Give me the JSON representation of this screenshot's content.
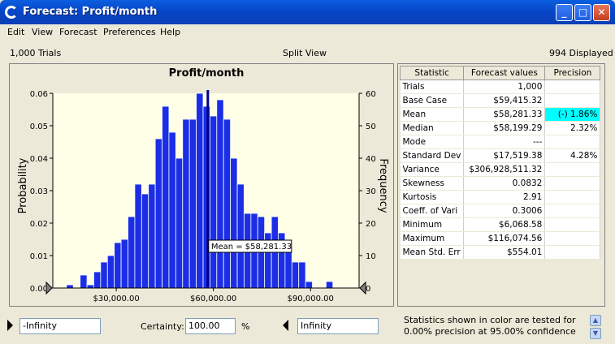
{
  "window": {
    "title": "Forecast: Profit/month"
  },
  "menu": [
    "Edit",
    "View",
    "Forecast",
    "Preferences",
    "Help"
  ],
  "info": {
    "trials": "1,000 Trials",
    "view": "Split View",
    "displayed": "994 Displayed"
  },
  "chart_data": {
    "type": "bar",
    "title": "Profit/month",
    "ylabel_left": "Probability",
    "ylabel_right": "Frequency",
    "xlim": [
      10400,
      105000
    ],
    "ylim_left": [
      0,
      0.06
    ],
    "ylim_right": [
      0,
      60
    ],
    "x_ticks": [
      30000,
      60000,
      90000
    ],
    "x_tick_labels": [
      "$30,000.00",
      "$60,000.00",
      "$90,000.00"
    ],
    "y_ticks_left": [
      "0.00",
      "0.01",
      "0.02",
      "0.03",
      "0.04",
      "0.05",
      "0.06"
    ],
    "y_ticks_right": [
      "0",
      "10",
      "20",
      "30",
      "40",
      "50",
      "60"
    ],
    "bin_start": 10400,
    "bin_width": 2110,
    "frequencies": [
      0,
      0,
      1,
      0,
      4,
      1,
      5,
      8,
      10,
      14,
      15,
      22,
      32,
      29,
      32,
      46,
      56,
      48,
      40,
      52,
      52,
      60,
      56,
      53,
      58,
      52,
      40,
      32,
      23,
      23,
      22,
      17,
      22,
      17,
      11,
      8,
      8,
      2,
      0,
      0,
      2
    ],
    "mean": 58281.33,
    "mean_label": "Mean = $58,281.33",
    "colors": {
      "bar": "#1b2ee6",
      "bar_edge": "#ffffff",
      "mean_line": "#00008b",
      "plot_bg": "#ffffe8"
    }
  },
  "stats": {
    "headers": [
      "Statistic",
      "Forecast values",
      "Precision"
    ],
    "rows": [
      {
        "name": "Trials",
        "value": "1,000",
        "precision": ""
      },
      {
        "name": "Base Case",
        "value": "$59,415.32",
        "precision": ""
      },
      {
        "name": "Mean",
        "value": "$58,281.33",
        "precision": "(-) 1.86%",
        "highlight": true
      },
      {
        "name": "Median",
        "value": "$58,199.29",
        "precision": "2.32%"
      },
      {
        "name": "Mode",
        "value": "---",
        "precision": ""
      },
      {
        "name": "Standard Dev",
        "value": "$17,519.38",
        "precision": "4.28%"
      },
      {
        "name": "Variance",
        "value": "$306,928,511.32",
        "precision": ""
      },
      {
        "name": "Skewness",
        "value": "0.0832",
        "precision": ""
      },
      {
        "name": "Kurtosis",
        "value": "2.91",
        "precision": ""
      },
      {
        "name": "Coeff. of Vari",
        "value": "0.3006",
        "precision": ""
      },
      {
        "name": "Minimum",
        "value": "$6,068.58",
        "precision": ""
      },
      {
        "name": "Maximum",
        "value": "$116,074.56",
        "precision": ""
      },
      {
        "name": "Mean  Std. Err",
        "value": "$554.01",
        "precision": ""
      }
    ]
  },
  "certainty": {
    "left_value": "-Infinity",
    "label": "Certainty:",
    "value": "100.00",
    "unit": "%",
    "right_value": "Infinity"
  },
  "footer_note": "Statistics shown in color are tested for 0.00% precision at 95.00% confidence"
}
